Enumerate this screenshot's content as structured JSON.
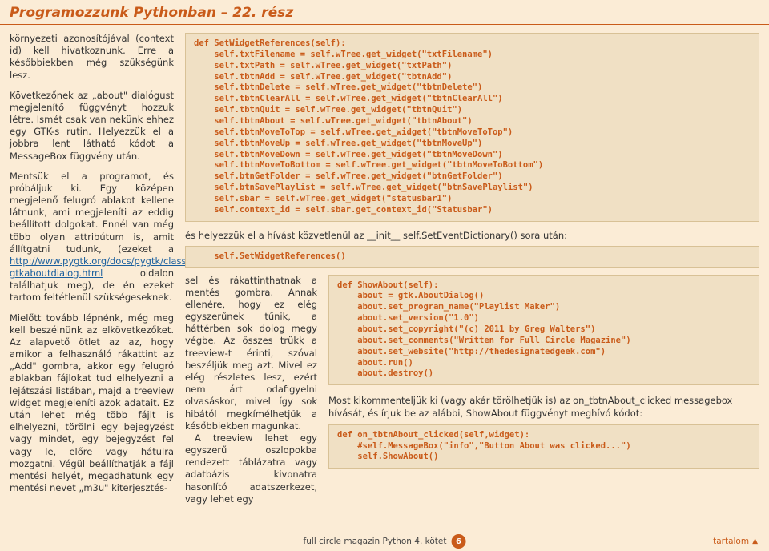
{
  "header": {
    "title": "Programozzunk Pythonban – 22. rész"
  },
  "left": {
    "p1": "környezeti azonosítójával (context id) kell hivatkoznunk. Erre a későbbiekben még szükségünk lesz.",
    "p2": "Következőnek az „about\" dialógust megjelenítő függvényt hozzuk létre. Ismét csak van nekünk ehhez egy GTK-s rutin. Helyezzük el a jobbra lent látható kódot a MessageBox függvény után.",
    "p3a": "Mentsük el a programot, és próbáljuk ki. Egy középen megjelenő felugró ablakot kellene látnunk, ami megjeleníti az eddig beállított dolgokat. Ennél van még több olyan attribútum is, amit állítgatni tudunk, (ezeket a ",
    "link": "http://www.pygtk.org/docs/pygtk/class-gtkaboutdialog.html",
    "p3b": " oldalon találhatjuk meg), de én ezeket tartom feltétlenül szükségeseknek.",
    "p4": "Mielőtt tovább lépnénk, még meg kell beszélnünk az elkövetkezőket. Az alapvető ötlet az az, hogy amikor a felhasználó rákattint az „Add\" gombra, akkor egy felugró ablakban fájlokat tud elhelyezni a lejátszási listában, majd a treeview widget megjeleníti azok adatait. Ez után lehet még több fájlt is elhelyezni, törölni egy bejegyzést vagy mindet, egy bejegyzést fel vagy le, előre vagy hátulra mozgatni. Végül beállíthatják a fájl mentési helyét, megadhatunk egy mentési nevet „m3u\" kiterjesztés-"
  },
  "code1": "def SetWidgetReferences(self):\n    self.txtFilename = self.wTree.get_widget(\"txtFilename\")\n    self.txtPath = self.wTree.get_widget(\"txtPath\")\n    self.tbtnAdd = self.wTree.get_widget(\"tbtnAdd\")\n    self.tbtnDelete = self.wTree.get_widget(\"tbtnDelete\")\n    self.tbtnClearAll = self.wTree.get_widget(\"tbtnClearAll\")\n    self.tbtnQuit = self.wTree.get_widget(\"tbtnQuit\")\n    self.tbtnAbout = self.wTree.get_widget(\"tbtnAbout\")\n    self.tbtnMoveToTop = self.wTree.get_widget(\"tbtnMoveToTop\")\n    self.tbtnMoveUp = self.wTree.get_widget(\"tbtnMoveUp\")\n    self.tbtnMoveDown = self.wTree.get_widget(\"tbtnMoveDown\")\n    self.tbtnMoveToBottom = self.wTree.get_widget(\"tbtnMoveToBottom\")\n    self.btnGetFolder = self.wTree.get_widget(\"btnGetFolder\")\n    self.btnSavePlaylist = self.wTree.get_widget(\"btnSavePlaylist\")\n    self.sbar = self.wTree.get_widget(\"statusbar1\")\n    self.context_id = self.sbar.get_context_id(\"Statusbar\")",
  "bridge": "és helyezzük el a hívást közvetlenül az __init__ self.SetEventDictionary() sora után:",
  "code_inline": "    self.SetWidgetReferences()",
  "mid": {
    "p1": "sel és rákattinthatnak a mentés gombra. Annak ellenére, hogy ez elég egyszerűnek tűnik, a háttérben sok dolog megy végbe. Az összes trükk a treeview-t érinti, szóval beszéljük meg azt. Mivel ez elég részletes lesz, ezért nem árt odafigyelni olvasáskor, mivel így sok hibától megkímélhetjük a későbbiekben magunkat.",
    "p2": "A treeview lehet egy egyszerű oszlopokba rendezett táblázatra vagy adatbázis kivonatra hasonlító adatszerkezet, vagy lehet egy"
  },
  "code2": "def ShowAbout(self):\n    about = gtk.AboutDialog()\n    about.set_program_name(\"Playlist Maker\")\n    about.set_version(\"1.0\")\n    about.set_copyright(\"(c) 2011 by Greg Walters\")\n    about.set_comments(\"Written for Full Circle Magazine\")\n    about.set_website(\"http://thedesignatedgeek.com\")\n    about.run()\n    about.destroy()",
  "para2": "Most kikommenteljük ki (vagy akár törölhetjük is) az on_tbtnAbout_clicked messagebox hívását, és írjuk be az alábbi, ShowAbout függvényt meghívó kódot:",
  "code3": "def on_tbtnAbout_clicked(self,widget):\n    #self.MessageBox(\"info\",\"Button About was clicked...\")\n    self.ShowAbout()",
  "footer": {
    "center": "full circle magazin Python 4. kötet",
    "page": "6",
    "right": "tartalom"
  }
}
